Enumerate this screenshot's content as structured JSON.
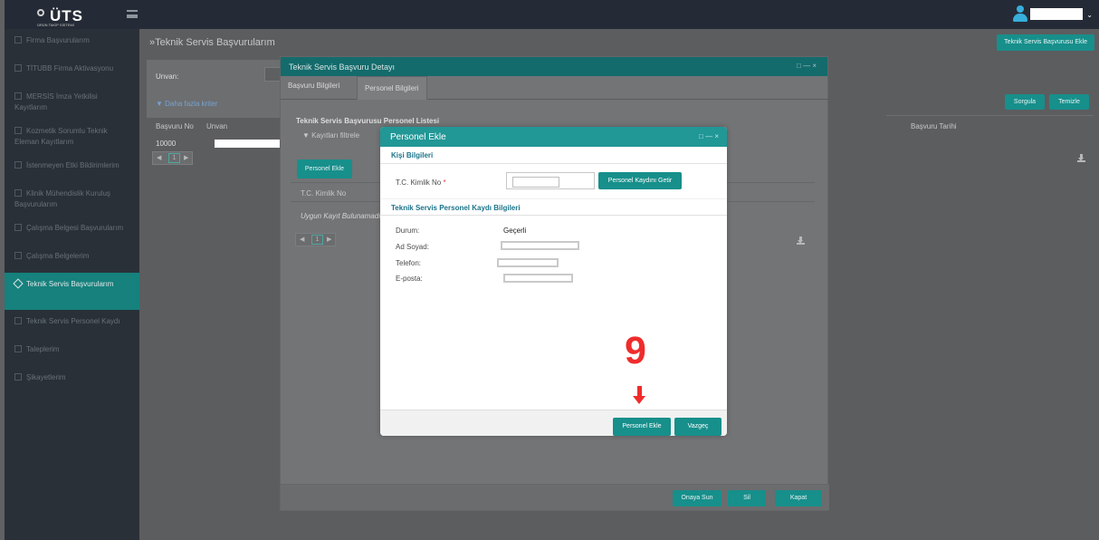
{
  "app": {
    "logo_text": "ÜTS",
    "logo_subtitle": "ÜRÜN TAKİP SİSTEMİ"
  },
  "header": {
    "user_icon": "user-icon",
    "menu_icon": "hamburger-menu-icon"
  },
  "sidebar": {
    "items": [
      {
        "label": "Firma Başvurularım",
        "icon": "document-icon"
      },
      {
        "label": "TİTUBB Firma Aktivasyonu",
        "icon": "document-icon"
      },
      {
        "label": "MERSİS İmza Yetkilisi Kayıtlarım",
        "icon": "document-icon"
      },
      {
        "label": "Kozmetik Sorumlu Teknik Eleman Kayıtlarım",
        "icon": "document-icon"
      },
      {
        "label": "İstenmeyen Etki Bildirimlerim",
        "icon": "alert-icon"
      },
      {
        "label": "Klinik Mühendislik Kuruluş Başvurularım",
        "icon": "network-icon"
      },
      {
        "label": "Çalışma Belgesi Başvurularım",
        "icon": "network-icon"
      },
      {
        "label": "Çalışma Belgelerim",
        "icon": "network-icon"
      },
      {
        "label": "Teknik Servis Başvurularım",
        "icon": "wrench-icon"
      },
      {
        "label": "Teknik Servis Personel Kaydı",
        "icon": "pencil-icon"
      },
      {
        "label": "Taleplerim",
        "icon": "search-icon"
      },
      {
        "label": "Şikayetlerim",
        "icon": "message-icon"
      }
    ]
  },
  "main": {
    "title": "»Teknik Servis Başvurularım",
    "top_action_label": "Teknik Servis Başvurusu Ekle",
    "filter_label": "Unvan:",
    "more_filters": "▼ Daha fazla kriter",
    "search_label": "Sorgula",
    "clear_label": "Temizle",
    "table_headers": {
      "application_no": "Başvuru No",
      "title": "Unvan",
      "application_date": "Başvuru Tarihi"
    },
    "table_row": {
      "application_no": "10000"
    },
    "pagination": {
      "previous_icon": "◀",
      "current": "1",
      "next_icon": "▶"
    }
  },
  "detail_window": {
    "title": "Teknik Servis Başvuru Detayı",
    "tabs": [
      "Başvuru Bilgileri",
      "Personel Bilgileri"
    ],
    "section_title": "Teknik Servis Başvurusu Personel Listesi",
    "filter_label": "▼ Kayıtları filtrele",
    "add_label": "Personel Ekle",
    "table_header": "T.C. Kimlik No",
    "empty_text": "Uygun Kayıt Bulunamadı",
    "pagination": {
      "previous_icon": "◀",
      "current": "1",
      "next_icon": "▶"
    },
    "footer_buttons": {
      "submit": "Onaya Sun",
      "delete": "Sil",
      "close": "Kapat"
    }
  },
  "modal": {
    "title": "Personel Ekle",
    "personal_section": "Kişi Bilgileri",
    "identity_label": "T.C. Kimlik No",
    "required_mark": "*",
    "fetch_button": "Personel Kaydını Getir",
    "record_section": "Teknik Servis Personel Kaydı Bilgileri",
    "status_label": "Durum:",
    "status_value": "Geçerli",
    "name_label": "Ad Soyad:",
    "phone_label": "Telefon:",
    "email_label": "E-posta:",
    "annotation_number": "9",
    "add_button": "Personel Ekle",
    "cancel_button": "Vazgeç"
  },
  "colors": {
    "teal": "#178f8b",
    "dark_sidebar": "#293038",
    "red_annotation": "#ef2c2c"
  }
}
